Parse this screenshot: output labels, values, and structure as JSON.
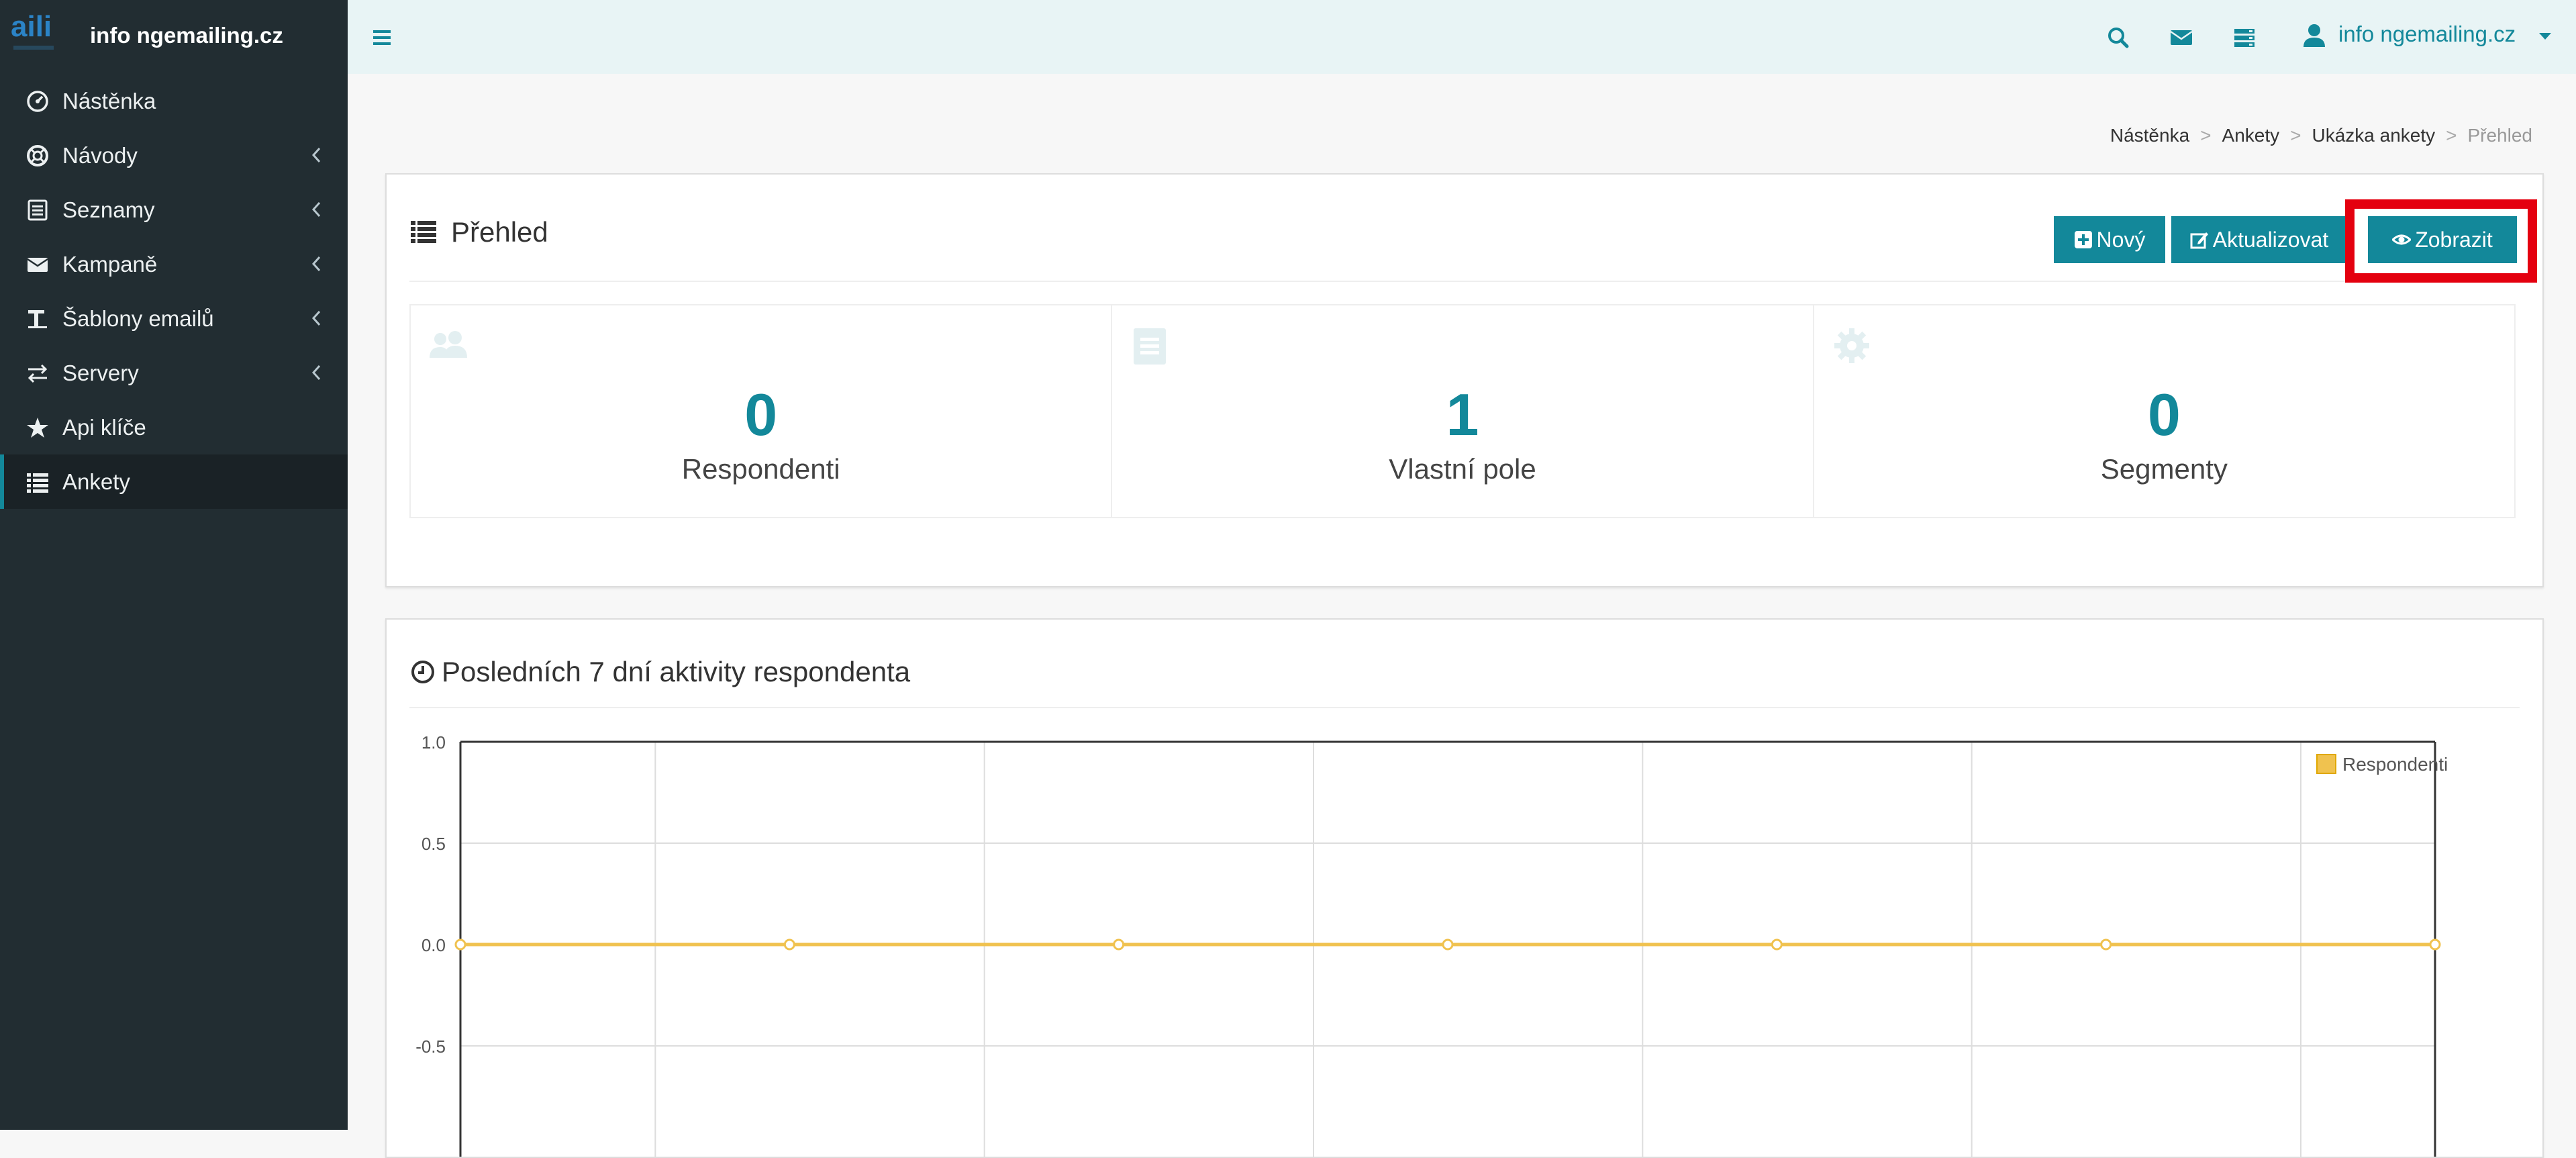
{
  "app": {
    "title": "info ngemailing.cz"
  },
  "sidebar": {
    "items": [
      {
        "label": "Nástěnka",
        "icon": "dashboard-icon",
        "chevron": false
      },
      {
        "label": "Návody",
        "icon": "lifebuoy-icon",
        "chevron": true
      },
      {
        "label": "Seznamy",
        "icon": "list-box-icon",
        "chevron": true
      },
      {
        "label": "Kampaně",
        "icon": "envelope-icon",
        "chevron": true
      },
      {
        "label": "Šablony emailů",
        "icon": "text-icon",
        "chevron": true
      },
      {
        "label": "Servery",
        "icon": "exchange-icon",
        "chevron": true
      },
      {
        "label": "Api klíče",
        "icon": "star-icon",
        "chevron": false
      },
      {
        "label": "Ankety",
        "icon": "list-icon",
        "chevron": false,
        "active": true
      }
    ]
  },
  "topbar": {
    "user_label": "info ngemailing.cz",
    "icons": [
      "menu-icon",
      "search-icon",
      "envelope-icon",
      "server-icon",
      "user-icon",
      "caret-down-icon"
    ]
  },
  "breadcrumb": [
    "Nástěnka",
    "Ankety",
    "Ukázka ankety",
    "Přehled"
  ],
  "overview": {
    "title": "Přehled",
    "buttons": {
      "new": "Nový",
      "update": "Aktualizovat",
      "show": "Zobrazit"
    },
    "stats": [
      {
        "value": "0",
        "label": "Respondenti",
        "icon": "users-icon"
      },
      {
        "value": "1",
        "label": "Vlastní pole",
        "icon": "document-icon"
      },
      {
        "value": "0",
        "label": "Segmenty",
        "icon": "gear-icon"
      }
    ]
  },
  "activity": {
    "title": "Posledních 7 dní aktivity respondenta"
  },
  "colors": {
    "accent": "#13889a",
    "sidebar": "#222d32",
    "highlight": "#e4000f",
    "series": "#f0c24f"
  },
  "chart_data": {
    "type": "line",
    "title": "Posledních 7 dní aktivity respondenta",
    "x": [
      1,
      2,
      3,
      4,
      5,
      6,
      7
    ],
    "series": [
      {
        "name": "Respondenti",
        "values": [
          0,
          0,
          0,
          0,
          0,
          0,
          0
        ]
      }
    ],
    "yticks": [
      "1.0",
      "0.5",
      "0.0",
      "-0.5"
    ],
    "ylim": [
      -1,
      1
    ],
    "grid": true,
    "legend": "top-right"
  }
}
